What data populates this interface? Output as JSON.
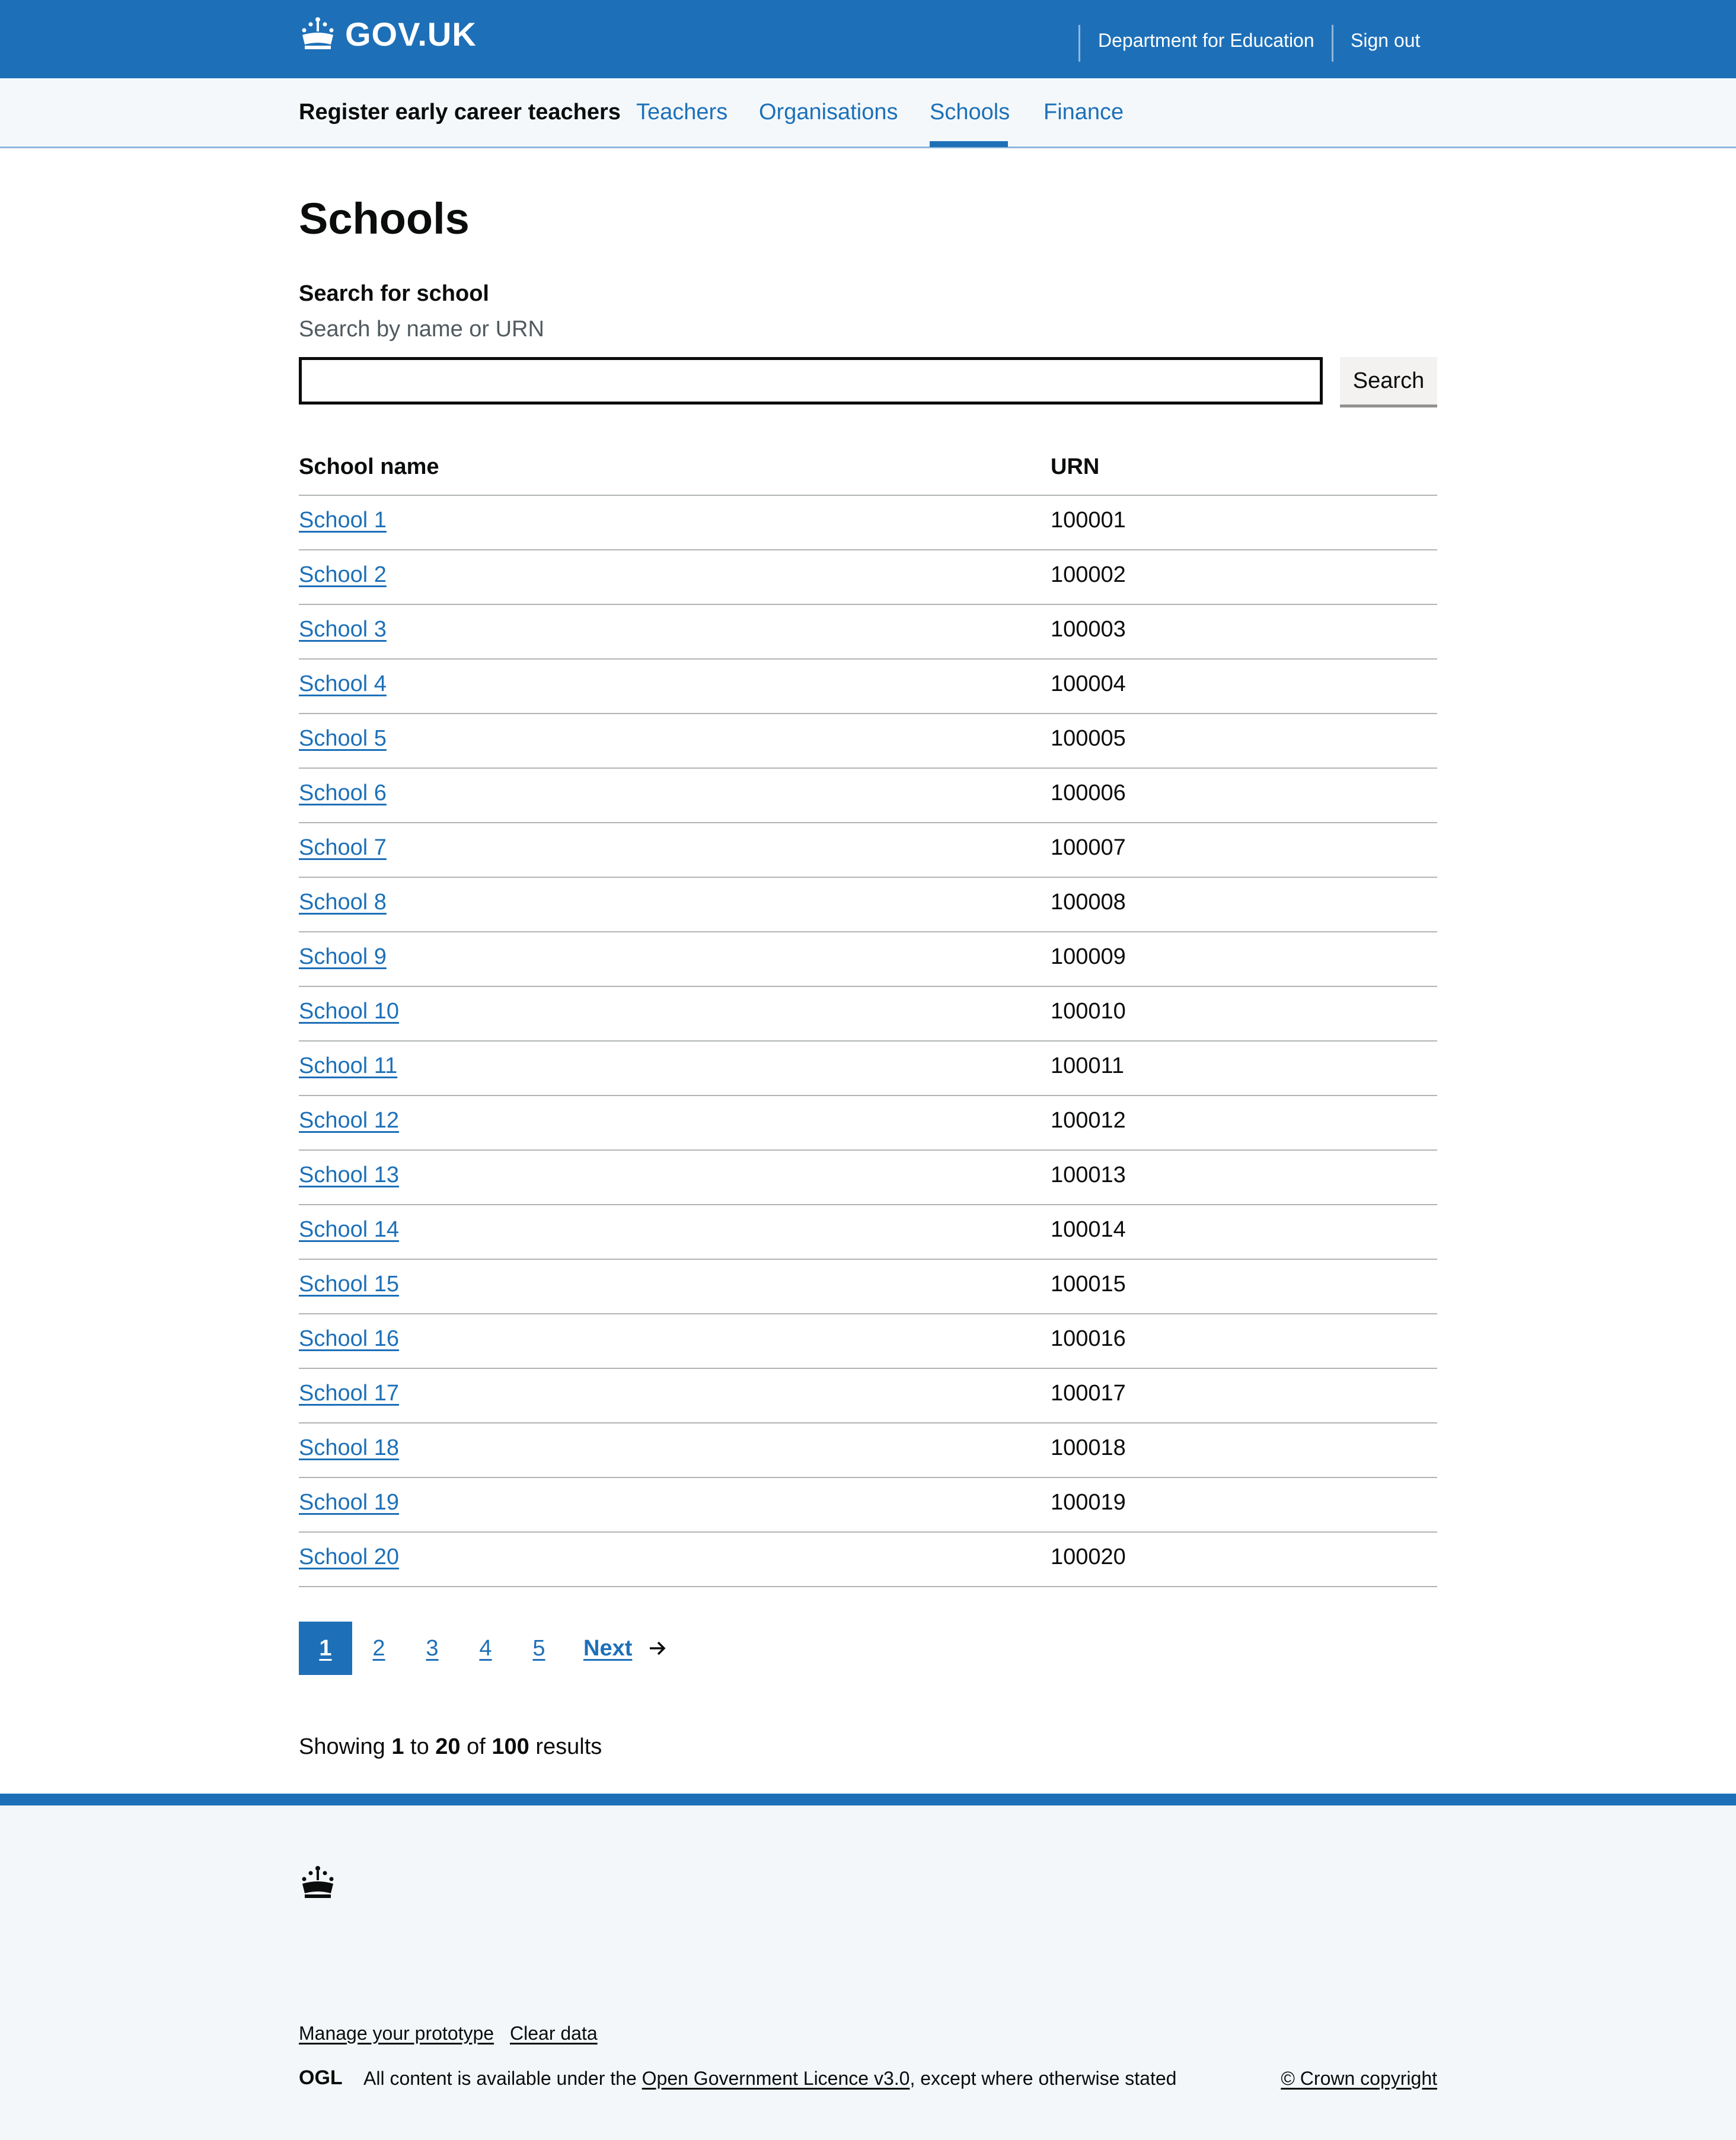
{
  "header": {
    "logo_text": "GOV.UK",
    "department_link": "Department for Education",
    "sign_out_link": "Sign out"
  },
  "service_nav": {
    "service_name": "Register early career teachers",
    "items": [
      {
        "label": "Teachers"
      },
      {
        "label": "Organisations"
      },
      {
        "label": "Schools",
        "active": true
      },
      {
        "label": "Finance"
      }
    ]
  },
  "main": {
    "title": "Schools",
    "search": {
      "label": "Search for school",
      "hint": "Search by name or URN",
      "value": "",
      "button_label": "Search"
    },
    "table": {
      "headers": [
        "School name",
        "URN"
      ],
      "rows": [
        {
          "name": "School 1",
          "urn": "100001"
        },
        {
          "name": "School 2",
          "urn": "100002"
        },
        {
          "name": "School 3",
          "urn": "100003"
        },
        {
          "name": "School 4",
          "urn": "100004"
        },
        {
          "name": "School 5",
          "urn": "100005"
        },
        {
          "name": "School 6",
          "urn": "100006"
        },
        {
          "name": "School 7",
          "urn": "100007"
        },
        {
          "name": "School 8",
          "urn": "100008"
        },
        {
          "name": "School 9",
          "urn": "100009"
        },
        {
          "name": "School 10",
          "urn": "100010"
        },
        {
          "name": "School 11",
          "urn": "100011"
        },
        {
          "name": "School 12",
          "urn": "100012"
        },
        {
          "name": "School 13",
          "urn": "100013"
        },
        {
          "name": "School 14",
          "urn": "100014"
        },
        {
          "name": "School 15",
          "urn": "100015"
        },
        {
          "name": "School 16",
          "urn": "100016"
        },
        {
          "name": "School 17",
          "urn": "100017"
        },
        {
          "name": "School 18",
          "urn": "100018"
        },
        {
          "name": "School 19",
          "urn": "100019"
        },
        {
          "name": "School 20",
          "urn": "100020"
        }
      ]
    },
    "pagination": {
      "pages": [
        "1",
        "2",
        "3",
        "4",
        "5"
      ],
      "current_page": "1",
      "next_label": "Next"
    },
    "results_summary": {
      "prefix": "Showing",
      "from": "1",
      "to_word": "to",
      "to": "20",
      "of_word": "of",
      "total": "100",
      "suffix": "results"
    }
  },
  "footer": {
    "links": [
      "Manage your prototype",
      "Clear data"
    ],
    "ogl_logo": "OGL",
    "licence_prefix": "All content is available under the",
    "licence_link": "Open Government Licence v3.0",
    "licence_suffix": ", except where otherwise stated",
    "copyright": "© Crown copyright"
  },
  "colors": {
    "brand_blue": "#1d70b8",
    "text": "#0b0c0c",
    "hint": "#505a5f",
    "footer_bg": "#f3f7fa"
  },
  "icons": [
    "crown-icon",
    "arrow-right-icon",
    "ogl-logo"
  ]
}
